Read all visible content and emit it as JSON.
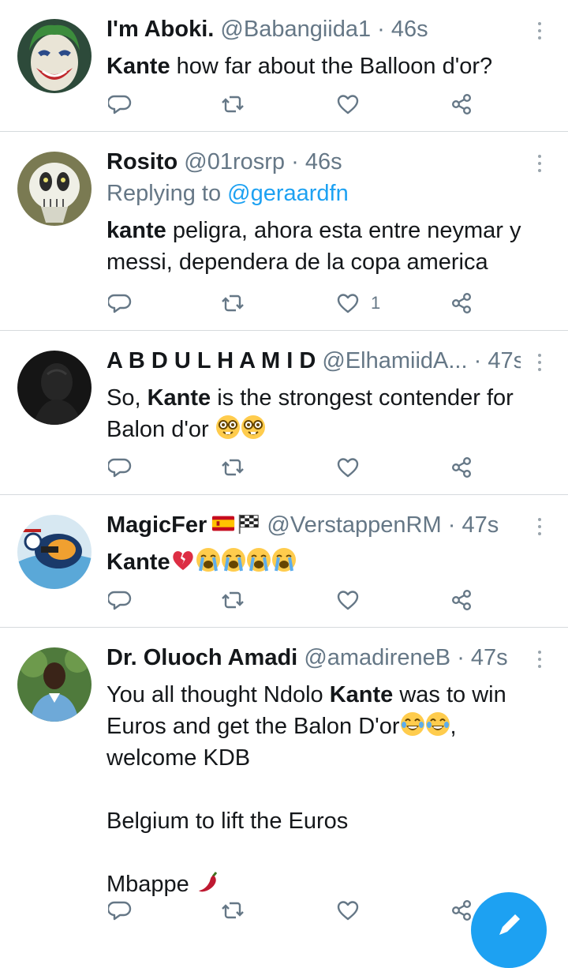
{
  "tweets": [
    {
      "name": "I'm Aboki.",
      "handle": "@Babangiida1",
      "sep": "·",
      "time": "46s",
      "avatar": "joker-avatar",
      "lines": [
        [
          {
            "t": "Kante",
            "b": true
          },
          {
            "t": " how far about the Balloon d'or?"
          }
        ]
      ],
      "likes": ""
    },
    {
      "name": "Rosito",
      "handle": "@01rosrp",
      "sep": "·",
      "time": "46s",
      "avatar": "skeleton-creature-avatar",
      "reply_prefix": "Replying to ",
      "reply_mention": "@geraardfn",
      "lines": [
        [
          {
            "t": "kante",
            "b": true
          },
          {
            "t": " peligra, ahora esta entre neymar y"
          }
        ],
        [
          {
            "t": "messi, dependera de la copa america"
          }
        ]
      ],
      "likes": "1"
    },
    {
      "name": "A B D U L H A M I D",
      "handle": "@ElhamiidA...",
      "sep": "·",
      "time": "47s",
      "avatar": "dark-silhouette-avatar",
      "lines": [
        [
          {
            "t": "So, "
          },
          {
            "t": "Kante",
            "b": true
          },
          {
            "t": " is the strongest contender for"
          }
        ],
        [
          {
            "t": "Balon d'or "
          },
          {
            "e": "nerd"
          },
          {
            "e": "nerd"
          }
        ]
      ],
      "likes": ""
    },
    {
      "name": "MagicFer",
      "name_emojis": [
        "flag-spain",
        "chequered-flag"
      ],
      "handle": "@VerstappenRM",
      "sep": "·",
      "time": "47s",
      "avatar": "race-car-avatar",
      "lines": [
        [
          {
            "t": "Kante",
            "b": true
          },
          {
            "e": "broken-heart"
          },
          {
            "e": "crying"
          },
          {
            "e": "crying"
          },
          {
            "e": "crying"
          },
          {
            "e": "crying"
          }
        ]
      ],
      "likes": ""
    },
    {
      "name": "Dr. Oluoch Amadi",
      "handle": "@amadireneB",
      "sep": "·",
      "time": "47s",
      "avatar": "man-portrait-avatar",
      "lines": [
        [
          {
            "t": "You all thought Ndolo "
          },
          {
            "t": "Kante",
            "b": true
          },
          {
            "t": " was to win"
          }
        ],
        [
          {
            "t": "Euros and get the Balon D'or"
          },
          {
            "e": "tears-of-joy"
          },
          {
            "e": "tears-of-joy"
          },
          {
            "t": ","
          }
        ],
        [
          {
            "t": "welcome KDB"
          }
        ],
        [
          {
            "t": ""
          }
        ],
        [
          {
            "t": "Belgium to lift the Euros"
          }
        ],
        [
          {
            "t": ""
          }
        ],
        [
          {
            "t": "Mbappe "
          },
          {
            "e": "hot-pepper"
          }
        ]
      ],
      "likes": ""
    }
  ],
  "icons": {
    "reply": "reply-icon",
    "retweet": "retweet-icon",
    "like": "like-icon",
    "share": "share-icon",
    "menu": "more-options-icon",
    "compose": "compose-tweet-icon"
  },
  "colors": {
    "accent": "#1da1f2",
    "secondary_text": "#657786",
    "divider": "#d6dadd",
    "primary_text": "#14171a"
  }
}
